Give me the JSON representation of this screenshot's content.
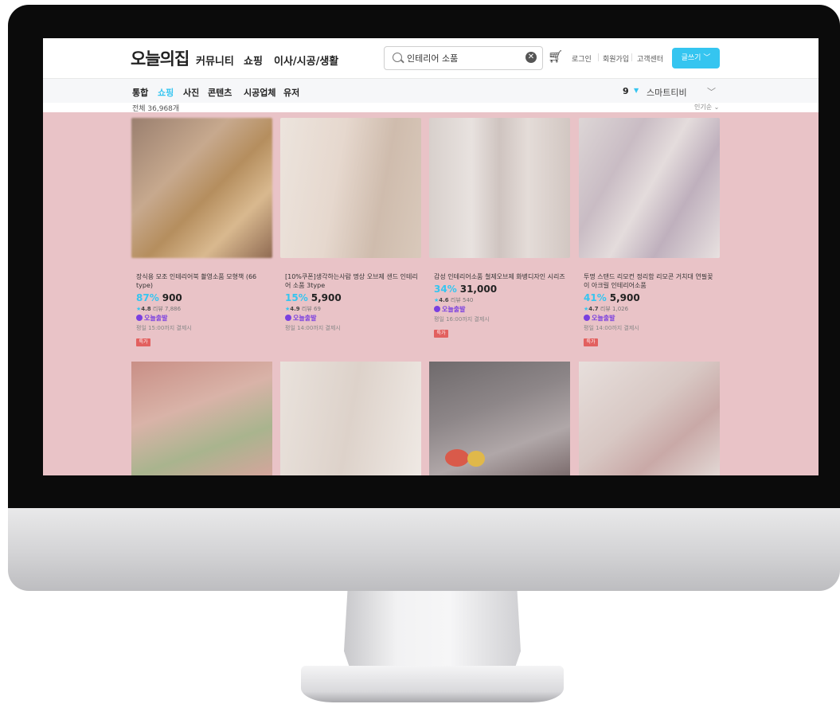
{
  "header": {
    "logo": "오늘의집",
    "nav": [
      "커뮤니티",
      "쇼핑",
      "이사/시공/생활"
    ],
    "search_value": "인테리어 소품",
    "login": "로그인",
    "signup": "회원가입",
    "support": "고객센터",
    "write_button": "글쓰기"
  },
  "subnav": {
    "tabs": [
      "통합",
      "쇼핑",
      "사진",
      "콘텐츠",
      "시공업체",
      "유저"
    ],
    "active_tab": "쇼핑",
    "filter_count": "9",
    "filter_label": "스마트티비"
  },
  "results": {
    "total": "전체 36,968개",
    "sort": "인기순"
  },
  "products": [
    {
      "title": "장식용 모조 인테리어북 촬영소품 모형책 (66 type)",
      "discount": "87%",
      "price": "900",
      "rating": "4.8",
      "reviews": "리뷰 7,886",
      "badge": "오늘출발",
      "shipping": "평일 15:00까지 결제시",
      "tag": "특가"
    },
    {
      "title": "[10%쿠폰]생각하는사람 명상 오브제 샌드 인테리어 소품 3type",
      "discount": "15%",
      "price": "5,900",
      "rating": "4.9",
      "reviews": "리뷰 69",
      "badge": "오늘출발",
      "shipping": "평일 14:00까지 결제시",
      "tag": ""
    },
    {
      "title": "감성 인테리어소품 철제오브제 화병디자인 시리즈",
      "discount": "34%",
      "price": "31,000",
      "rating": "4.6",
      "reviews": "리뷰 540",
      "badge": "오늘출발",
      "shipping": "평일 16:00까지 결제시",
      "tag": "특가"
    },
    {
      "title": "투명 스탠드 리모컨 정리함 리모콘 거치대 연필꽂이 아크릴 인테리어소품",
      "discount": "41%",
      "price": "5,900",
      "rating": "4.7",
      "reviews": "리뷰 1,026",
      "badge": "오늘출발",
      "shipping": "평일 14:00까지 결제시",
      "tag": "특가"
    }
  ],
  "colors": {
    "accent": "#35c5f0",
    "overlay": "#e9c3c7",
    "badge": "#7a3fe0",
    "tag": "#e2605f"
  },
  "icons": [
    "search-icon",
    "clear-icon",
    "cart-icon",
    "chevron-down-icon",
    "star-icon"
  ]
}
